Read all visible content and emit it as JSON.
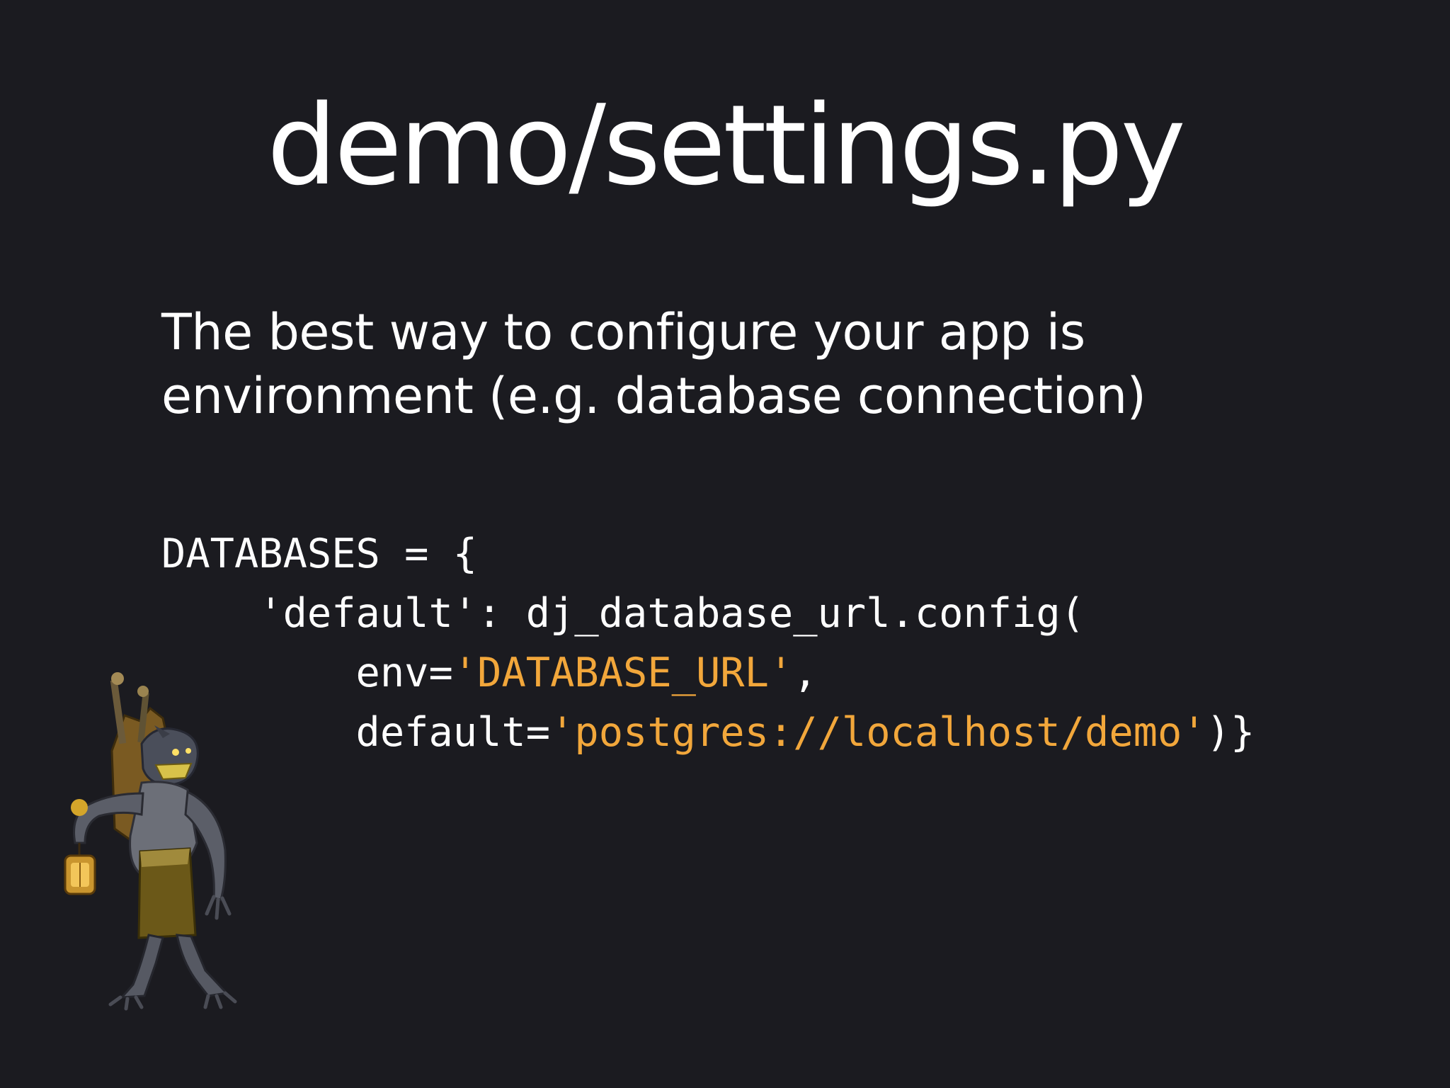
{
  "slide": {
    "title": "demo/settings.py",
    "body_lines": [
      "The best way to configure your app is",
      "environment (e.g. database connection)"
    ],
    "code": {
      "line1": "DATABASES = {",
      "line2": "    'default': dj_database_url.config(",
      "line3_prefix": "        env=",
      "line3_string": "'DATABASE_URL'",
      "line3_suffix": ",",
      "line4_prefix": "        default=",
      "line4_string": "'postgres://localhost/demo'",
      "line4_suffix": ")}"
    },
    "colors": {
      "background": "#1b1b20",
      "text": "#ffffff",
      "string_literal": "#f2a73b"
    },
    "illustration": "goblin-with-lantern-icon"
  }
}
